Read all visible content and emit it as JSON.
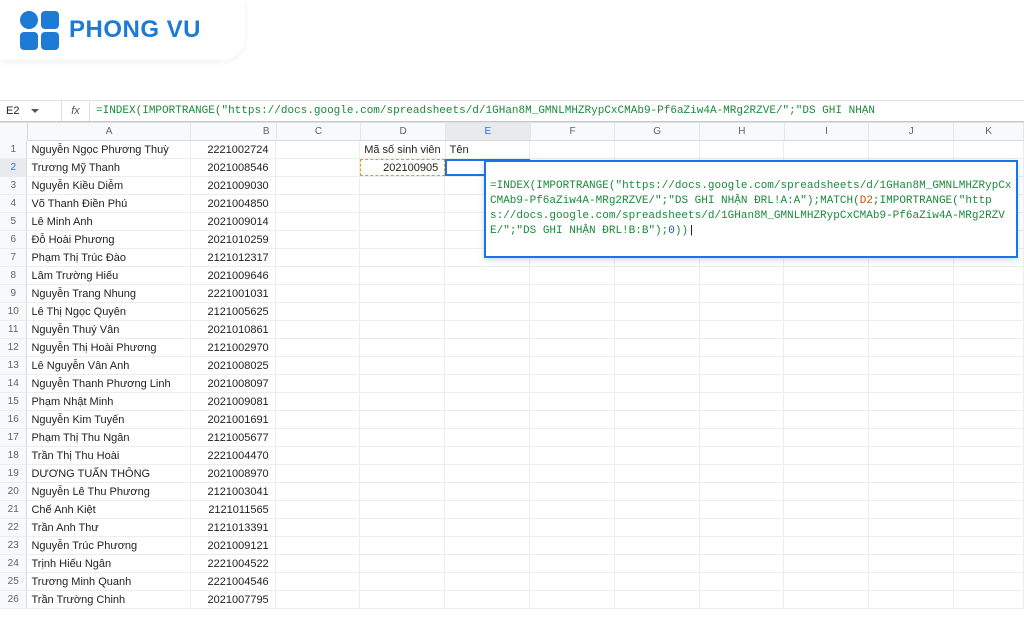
{
  "brand": {
    "name": "PHONG VU"
  },
  "name_box": {
    "value": "E2"
  },
  "fx": {
    "label": "fx",
    "lead": " =",
    "fn1": "INDEX",
    "p1": "(",
    "fn2": "IMPORTRANGE",
    "p2": "(",
    "str_url": "\"https://docs.google.com/spreadsheets/d/1GHan8M_GMNLMHZRypCxCMAb9-Pf6aZiw4A-MRg2RZVE/\"",
    "sep1": ";",
    "str_sheet1": "\"DS GHI NHẬN"
  },
  "popup": {
    "t0": "=",
    "fn1": "INDEX",
    "p1": "(",
    "fn2": "IMPORTRANGE",
    "p2": "(",
    "url": "\"https://docs.google.com/spreadsheets/d/1GHan8M_GMNLMHZRypCxCMAb9-Pf6aZiw4A-MRg2RZVE/\"",
    "sep1": ";",
    "sheet1": "\"DS GHI NHẬN ĐRL!A:A\"",
    "p3": ")",
    "sep2": ";",
    "fn3": "MATCH",
    "p4": "(",
    "ref": "D2",
    "sep3": ";",
    "fn4": "IMPORTRANGE",
    "p5": "(",
    "url2": "\"https://docs.google.com/spreadsheets/d/1GHan8M_GMNLMHZRypCxCMAb9-Pf6aZiw4A-MRg2RZVE/\"",
    "sep4": ";",
    "sheet2": "\"DS GHI NHẬN ĐRL!B:B\"",
    "p6": ")",
    "sep5": ";",
    "zero": "0",
    "p7": "))"
  },
  "columns": [
    "A",
    "B",
    "C",
    "D",
    "E",
    "F",
    "G",
    "H",
    "I",
    "J",
    "K"
  ],
  "headers_row1": {
    "D": "Mã số sinh viên",
    "E": "Tên"
  },
  "d2_value": "202100905",
  "rows": [
    {
      "n": 1,
      "a": "Nguyễn Ngọc Phương Thuỳ",
      "b": "2221002724"
    },
    {
      "n": 2,
      "a": "Trương Mỹ Thanh",
      "b": "2021008546"
    },
    {
      "n": 3,
      "a": "Nguyễn Kiều Diễm",
      "b": "2021009030"
    },
    {
      "n": 4,
      "a": "Võ Thanh Điền Phú",
      "b": "2021004850"
    },
    {
      "n": 5,
      "a": "Lê Minh Anh",
      "b": "2021009014"
    },
    {
      "n": 6,
      "a": "Đỗ Hoài Phương",
      "b": "2021010259"
    },
    {
      "n": 7,
      "a": "Phạm Thị Trúc Đào",
      "b": "2121012317"
    },
    {
      "n": 8,
      "a": "Lâm Trường Hiếu",
      "b": "2021009646"
    },
    {
      "n": 9,
      "a": "Nguyễn Trang Nhung",
      "b": "2221001031"
    },
    {
      "n": 10,
      "a": "Lê Thị Ngọc Quyên",
      "b": "2121005625"
    },
    {
      "n": 11,
      "a": "Nguyễn Thuý Vân",
      "b": "2021010861"
    },
    {
      "n": 12,
      "a": "Nguyễn Thị Hoài Phương",
      "b": "2121002970"
    },
    {
      "n": 13,
      "a": "Lê Nguyễn Vân Anh",
      "b": "2021008025"
    },
    {
      "n": 14,
      "a": "Nguyễn Thanh Phương Linh",
      "b": "2021008097"
    },
    {
      "n": 15,
      "a": "Phạm Nhật Minh",
      "b": "2021009081"
    },
    {
      "n": 16,
      "a": "Nguyễn Kim Tuyến",
      "b": "2021001691"
    },
    {
      "n": 17,
      "a": "Phạm Thị Thu Ngân",
      "b": "2121005677"
    },
    {
      "n": 18,
      "a": "Trần Thị Thu Hoài",
      "b": "2221004470"
    },
    {
      "n": 19,
      "a": "DƯƠNG TUẤN THÔNG",
      "b": "2021008970"
    },
    {
      "n": 20,
      "a": "Nguyễn Lê Thu Phương",
      "b": "2121003041"
    },
    {
      "n": 21,
      "a": "Chế Anh Kiệt",
      "b": "2121011565"
    },
    {
      "n": 22,
      "a": "Trần Anh Thư",
      "b": "2121013391"
    },
    {
      "n": 23,
      "a": "Nguyễn Trúc Phương",
      "b": "2021009121"
    },
    {
      "n": 24,
      "a": "Trịnh Hiếu Ngân",
      "b": "2221004522"
    },
    {
      "n": 25,
      "a": "Trương Minh Quanh",
      "b": "2221004546"
    },
    {
      "n": 26,
      "a": "Trần Trường Chinh",
      "b": "2021007795"
    }
  ]
}
